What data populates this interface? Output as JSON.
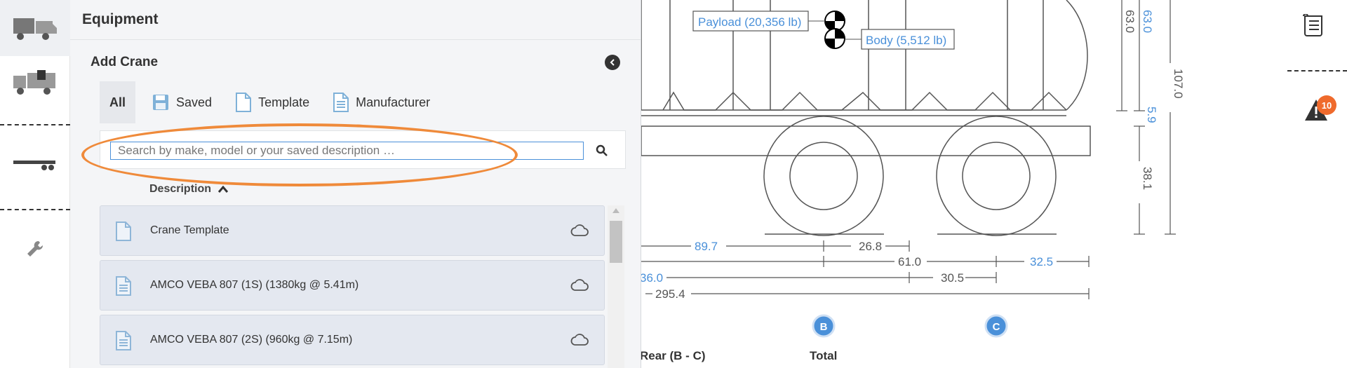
{
  "panel": {
    "title": "Equipment",
    "section_title": "Add Crane",
    "tabs": [
      {
        "label": "All",
        "active": true
      },
      {
        "label": "Saved",
        "icon": "floppy-disk-icon"
      },
      {
        "label": "Template",
        "icon": "document-icon"
      },
      {
        "label": "Manufacturer",
        "icon": "document-lines-icon"
      }
    ],
    "search": {
      "placeholder": "Search by make, model or your saved description …",
      "value": ""
    },
    "column_header": "Description",
    "rows": [
      {
        "label": "Crane Template",
        "icon": "document-icon"
      },
      {
        "label": "AMCO VEBA 807 (1S) (1380kg @ 5.41m)",
        "icon": "document-lines-icon"
      },
      {
        "label": "AMCO VEBA 807 (2S) (960kg @ 7.15m)",
        "icon": "document-lines-icon"
      }
    ]
  },
  "drawing": {
    "payload_label": "Payload (20,356 lb)",
    "body_label": "Body (5,512 lb)",
    "dims": {
      "d89_7": "89.7",
      "d26_8": "26.8",
      "d61_0": "61.0",
      "d32_5": "32.5",
      "d36_0": "36.0",
      "d30_5": "30.5",
      "d295_4": "295.4",
      "v63_0a": "63.0",
      "v63_0b": "63.0",
      "v107_0": "107.0",
      "v5_9": "5.9",
      "v38_1": "38.1"
    },
    "axle_b": "B",
    "axle_c": "C",
    "col_rear": "Rear (B - C)",
    "col_total": "Total"
  },
  "alerts": {
    "count": "10"
  },
  "colors": {
    "accent_blue": "#4a90d9",
    "highlight_orange": "#ef8a3a",
    "badge_orange": "#ef6a2c"
  }
}
